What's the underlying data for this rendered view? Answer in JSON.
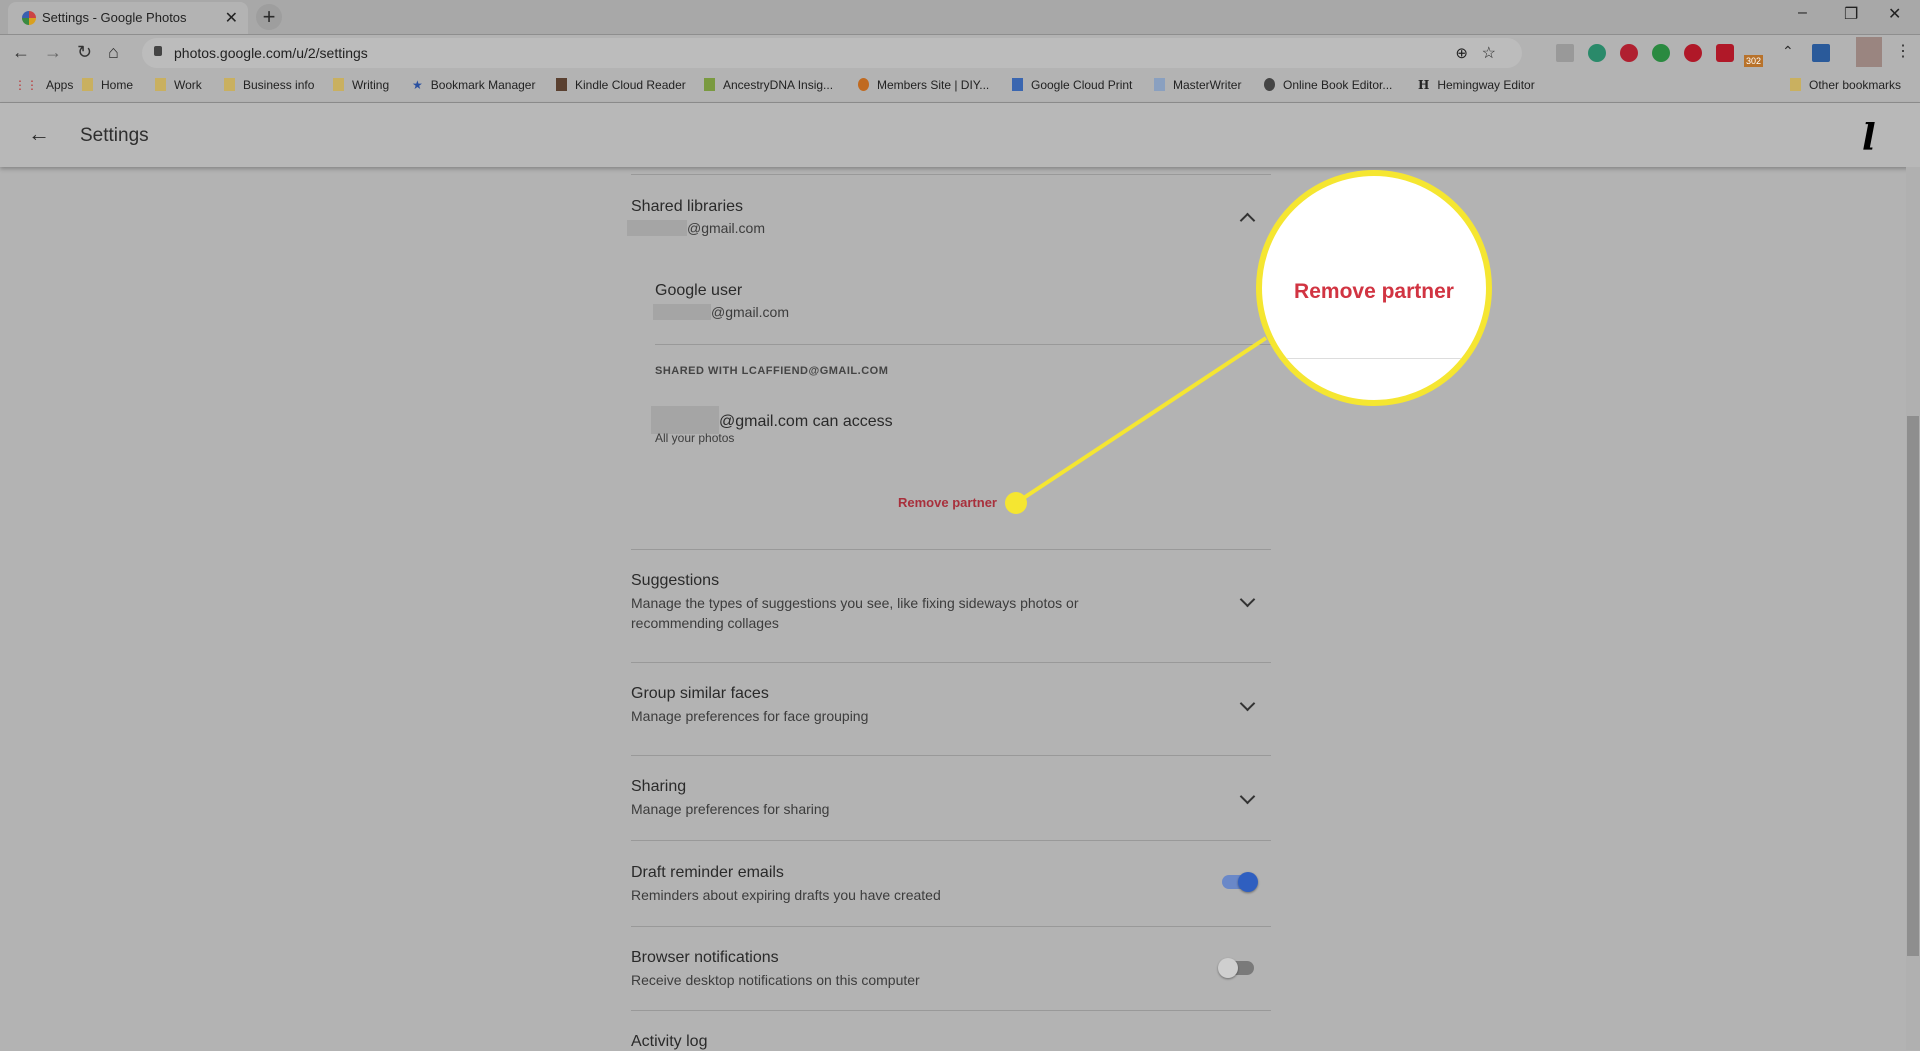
{
  "browser": {
    "tab_title": "Settings - Google Photos",
    "url": "photos.google.com/u/2/settings",
    "extension_badge": "302",
    "bookmarks": [
      "Apps",
      "Home",
      "Work",
      "Business info",
      "Writing",
      "Bookmark Manager",
      "Kindle Cloud Reader",
      "AncestryDNA Insig...",
      "Members Site | DIY...",
      "Google Cloud Print",
      "MasterWriter",
      "Online Book Editor...",
      "Hemingway Editor"
    ],
    "other_bookmarks": "Other bookmarks"
  },
  "header": {
    "title": "Settings"
  },
  "shared_libraries": {
    "title": "Shared libraries",
    "email": "@gmail.com",
    "partner_name": "Google user",
    "partner_email": "@gmail.com",
    "shared_with": "SHARED WITH LCAFFIEND@GMAIL.COM",
    "access": "@gmail.com can access",
    "access_detail": "All your photos",
    "remove": "Remove partner"
  },
  "sections": [
    {
      "title": "Suggestions",
      "desc1": "Manage the types of suggestions you see, like fixing sideways photos or",
      "desc2": "recommending collages"
    },
    {
      "title": "Group similar faces",
      "desc1": "Manage preferences for face grouping"
    },
    {
      "title": "Sharing",
      "desc1": "Manage preferences for sharing"
    },
    {
      "title": "Draft reminder emails",
      "desc1": "Reminders about expiring drafts you have created",
      "toggle": true
    },
    {
      "title": "Browser notifications",
      "desc1": "Receive desktop notifications on this computer",
      "toggle": false
    },
    {
      "title": "Activity log"
    }
  ],
  "callout": {
    "text": "Remove partner"
  },
  "colors": {
    "accent": "#2f5fc0",
    "remove": "#a8303c",
    "highlight": "#f5e631"
  }
}
